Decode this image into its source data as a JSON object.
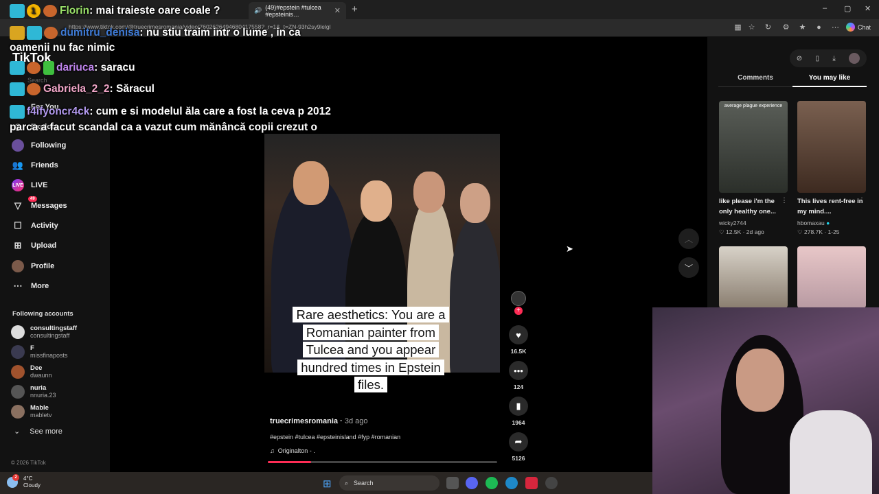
{
  "browser": {
    "tabs": [
      {
        "label": "(49)#epstein #tulcea #epsteinis…",
        "active": true
      }
    ],
    "new_tab_symbol": "+",
    "url": "https://www.tiktok.com/@truecrimesromania/video/7602626494680417558?_r=1&_t=ZN-93h2sy9lelgl",
    "copilot_label": "Chat",
    "window_controls": [
      "–",
      "▢",
      "✕"
    ]
  },
  "sidebar": {
    "logo": "TikTok",
    "search_placeholder": "Search",
    "items": [
      {
        "label": "For You",
        "icon": "home-icon"
      },
      {
        "label": "Explore",
        "icon": "compass-icon"
      },
      {
        "label": "Following",
        "icon": "following-icon"
      },
      {
        "label": "Friends",
        "icon": "friends-icon"
      },
      {
        "label": "LIVE",
        "icon": "live-icon"
      },
      {
        "label": "Messages",
        "icon": "messages-icon",
        "badge": "49"
      },
      {
        "label": "Activity",
        "icon": "activity-icon"
      },
      {
        "label": "Upload",
        "icon": "upload-icon"
      },
      {
        "label": "Profile",
        "icon": "profile-icon"
      },
      {
        "label": "More",
        "icon": "more-icon"
      }
    ],
    "following_title": "Following accounts",
    "following": [
      {
        "name": "consultingstaff",
        "handle": "consultingstaff"
      },
      {
        "name": "F",
        "handle": "missfinaposts"
      },
      {
        "name": "Dee",
        "handle": "dwaunn"
      },
      {
        "name": "nuria",
        "handle": "nnuria.23"
      },
      {
        "name": "Mable",
        "handle": "mabletv"
      }
    ],
    "see_more": "See more",
    "copyright": "© 2026 TikTok"
  },
  "video": {
    "caption_overlay": "Rare aesthetics: You are a Romanian painter from Tulcea and you appear hundred times in Epstein files.",
    "author": "truecrimesromania",
    "ago": "3d ago",
    "hashtags": "#epstein #tulcea #epsteinisland #fyp #romanian",
    "sound": "Originalton - .",
    "progress": 0.19,
    "likes": "16.5K",
    "comments": "124",
    "saves": "1964",
    "shares": "5126"
  },
  "right_panel": {
    "tabs": [
      "Comments",
      "You may like"
    ],
    "active_tab": "You may like",
    "cards": [
      {
        "thumb_caption": "average plague experience",
        "title": "like please i'm the only healthy one...",
        "author": "wicky2744",
        "likes": "12.5K",
        "date": "2d ago"
      },
      {
        "thumb_caption": "",
        "title": "This lives rent-free in my mind....",
        "author": "hbomaxau",
        "likes": "278.7K",
        "date": "1-25"
      },
      {
        "thumb_caption": "",
        "title": "",
        "author": "",
        "likes": "",
        "date": ""
      },
      {
        "thumb_caption": "",
        "title": "",
        "author": "",
        "likes": "",
        "date": ""
      }
    ]
  },
  "chat": [
    {
      "user": "Florin",
      "msg": "mai traieste oare coale ?"
    },
    {
      "user": "dumitru_denisa",
      "msg": "nu stiu traim intr o lume , in ca oamenii nu fac nimic"
    },
    {
      "user": "dariuca",
      "msg": "saracu"
    },
    {
      "user": "Gabriela_2_2",
      "msg": "Săracul"
    },
    {
      "user": "f4ifyoncr4ck",
      "msg": "cum e si modelul ăla care a fost la ceva p 2012 parca a facut scandal ca a vazut cum mănâncă copii crezut o"
    }
  ],
  "chat_coin": "1",
  "taskbar": {
    "temp": "4°C",
    "weather": "Cloudy",
    "weather_badge": "2",
    "search": "Search"
  },
  "colors": {
    "accent": "#fe2c55",
    "background": "#000000",
    "panel": "#121212"
  }
}
